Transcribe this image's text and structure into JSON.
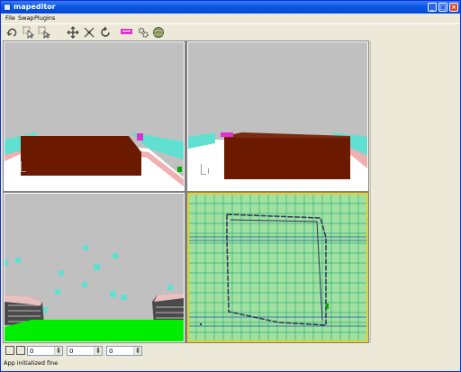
{
  "window": {
    "title": "mapeditor"
  },
  "menu": {
    "items": [
      "File",
      "Swap",
      "Plugins"
    ]
  },
  "toolbar": {
    "icons": [
      "undo-icon",
      "select-icon",
      "select-add-icon",
      "move-icon",
      "scale-icon",
      "rotate-icon",
      "entity-tag-icon",
      "settings-icon",
      "globe-icon"
    ]
  },
  "viewports": {
    "top_left": {
      "tag_color": "#E030D0"
    },
    "top_right": {
      "tag_color": "#E030D0"
    },
    "bottom_right": {
      "border_color": "#E8D028"
    }
  },
  "coords": {
    "x": "0",
    "y": "0",
    "z": "0"
  },
  "status": {
    "text": "App initialized fine"
  },
  "colors": {
    "sky": "#C0C0C0",
    "block": "#6B1A00",
    "cyan": "#60E0D0",
    "floor_green": "#00EE00",
    "grid_bg": "#A0E0A0",
    "path": "#30305A"
  }
}
